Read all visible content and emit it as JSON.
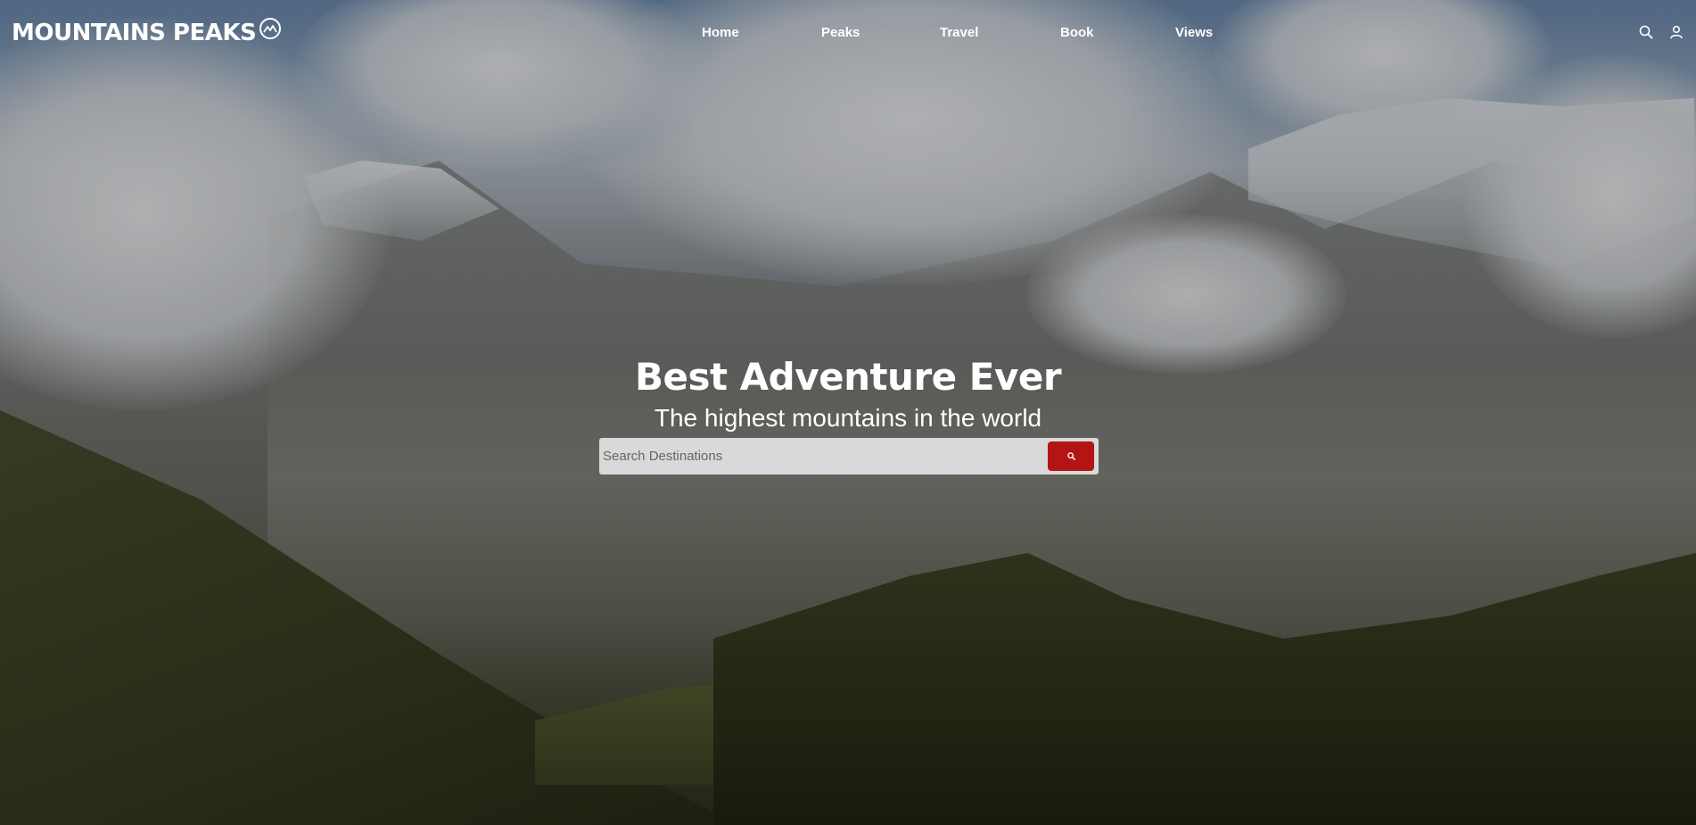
{
  "brand": {
    "name": "MOUNTAINS PEAKS",
    "logo_icon": "mountain-badge-icon"
  },
  "nav": {
    "items": [
      {
        "label": "Home"
      },
      {
        "label": "Peaks"
      },
      {
        "label": "Travel"
      },
      {
        "label": "Book"
      },
      {
        "label": "Views"
      }
    ]
  },
  "header_icons": [
    "search-icon",
    "user-icon"
  ],
  "hero": {
    "title": "Best Adventure Ever",
    "subtitle": "The highest mountains in the world"
  },
  "search": {
    "placeholder": "Search Destinations",
    "value": "",
    "button_icon": "search-icon",
    "button_color": "#b51414"
  },
  "colors": {
    "accent": "#b51414",
    "text": "#ffffff"
  }
}
